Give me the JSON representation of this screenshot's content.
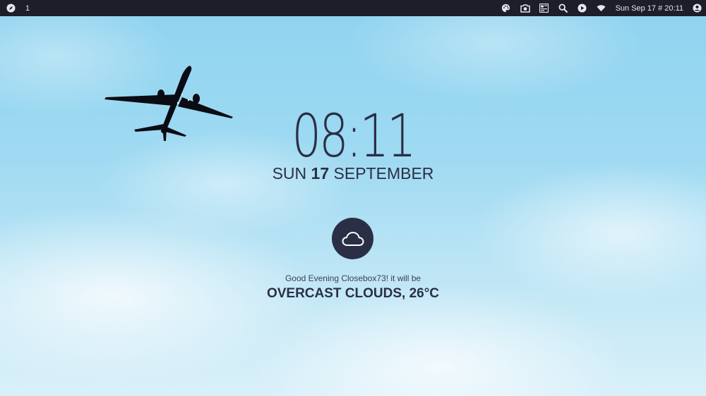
{
  "topbar": {
    "workspace": "1",
    "datetime": "Sun Sep 17 # 20:11",
    "icons": [
      "compass-icon",
      "palette-icon",
      "camera-icon",
      "dashboard-icon",
      "search-icon",
      "play-icon",
      "wifi-icon",
      "user-icon"
    ]
  },
  "clock": {
    "time": "08:11"
  },
  "date": {
    "weekday": "SUN",
    "day": "17",
    "month": "SEPTEMBER"
  },
  "weather": {
    "icon": "cloud-icon",
    "greeting": "Good Evening Closebox73! it will be",
    "condition": "OVERCAST CLOUDS, 26°C"
  },
  "colors": {
    "bar_bg": "#1e1e2b",
    "text_dark": "#2b2f45",
    "sky": "#9fdaf2"
  }
}
